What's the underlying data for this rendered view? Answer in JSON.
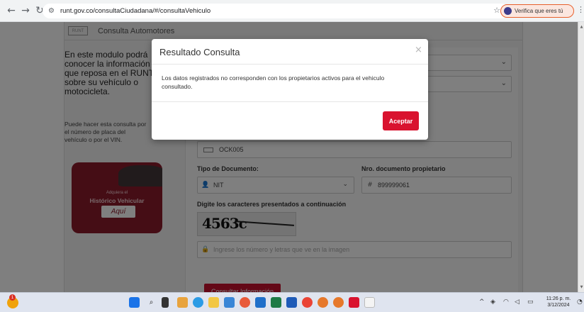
{
  "browser": {
    "url": "runt.gov.co/consultaCiudadana/#/consultaVehiculo",
    "verify_label": "Verifica que eres tú"
  },
  "page": {
    "header_title": "Consulta Automotores",
    "logo_text": "RUNT",
    "intro_text": "En este modulo podrá conocer la información que reposa en el RUNT sobre su vehículo o motocicleta.",
    "hint_text": "Puede hacer esta consulta por el número de placa del vehículo o por el VIN.",
    "promo": {
      "line1": "Adquiera el",
      "line2": "Histórico Vehicular",
      "button": "Aquí"
    },
    "form": {
      "plate_value": "OCK005",
      "doc_type_label": "Tipo de Documento:",
      "doc_type_value": "NIT",
      "doc_number_label": "Nro. documento propietario",
      "doc_number_value": "899999061",
      "captcha_label": "Digite los caracteres presentados a continuación",
      "captcha_code": "4563c",
      "captcha_placeholder": "Ingrese los número y letras que ve en la imagen",
      "submit_label": "Consultar Información"
    }
  },
  "modal": {
    "title": "Resultado Consulta",
    "close_glyph": "×",
    "message": "Los datos registrados no corresponden con los propietarios activos para el vehiculo consultado.",
    "accept_label": "Aceptar"
  },
  "taskbar": {
    "weather_badge": "1",
    "time": "11:26 p. m.",
    "date": "3/12/2024"
  },
  "colors": {
    "accent_red": "#d9132f",
    "verify_border": "#e8602c",
    "promo_bg": "#8b1a2b"
  }
}
